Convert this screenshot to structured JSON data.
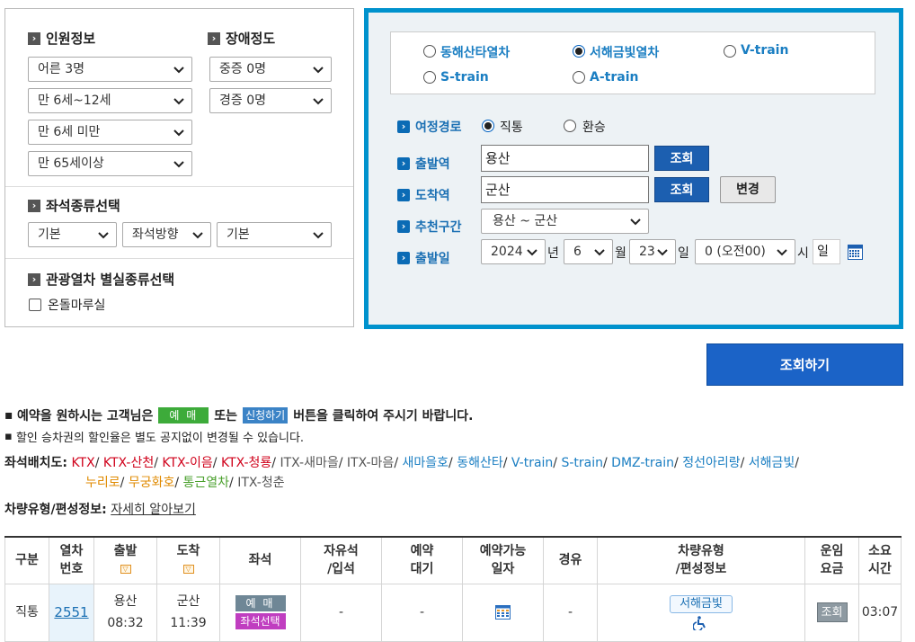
{
  "passenger": {
    "heading": "인원정보",
    "adult": "어른 3명",
    "child": "만 6세~12세",
    "infant": "만 6세 미만",
    "senior": "만 65세이상"
  },
  "disability": {
    "heading": "장애정도",
    "severe": "중증 0명",
    "mild": "경증 0명"
  },
  "seat_type": {
    "heading": "좌석종류선택",
    "type": "기본",
    "direction": "좌석방향",
    "position": "기본"
  },
  "tour_room": {
    "heading": "관광열차 별실종류선택",
    "ondol": "온돌마루실"
  },
  "trains": {
    "donghae": "동해산타열차",
    "seohae": "서해금빛열차",
    "vtrain": "V-train",
    "strain": "S-train",
    "atrain": "A-train"
  },
  "route": {
    "label": "여정경로",
    "direct": "직통",
    "transfer": "환승"
  },
  "departure": {
    "label": "출발역",
    "value": "용산",
    "lookup": "조회"
  },
  "arrival": {
    "label": "도착역",
    "value": "군산",
    "lookup": "조회",
    "swap": "변경"
  },
  "recommend": {
    "label": "추천구간",
    "value": "용산 ~ 군산"
  },
  "date": {
    "label": "출발일",
    "year": "2024",
    "year_unit": "년",
    "month": "6",
    "month_unit": "월",
    "day": "23",
    "day_unit": "일",
    "hour": "0 (오전00)",
    "hour_unit": "시",
    "weekday": "일"
  },
  "search_button": "조회하기",
  "notices": {
    "line1_a": "예약을 원하시는 고객님은",
    "line1_tag1": "예 매",
    "line1_b": "또는",
    "line1_tag2": "신청하기",
    "line1_c": "버튼을 클릭하여 주시기 바랍니다.",
    "line2": "할인 승차권의 할인율은 별도 공지없이 변경될 수 있습니다."
  },
  "seat_layout": {
    "label": "좌석배치도:",
    "items": [
      {
        "name": "KTX",
        "color": "#d0021b"
      },
      {
        "name": "KTX-산천",
        "color": "#d0021b"
      },
      {
        "name": "KTX-이음",
        "color": "#d0021b"
      },
      {
        "name": "KTX-청룡",
        "color": "#d0021b"
      },
      {
        "name": "ITX-새마을",
        "color": "#555555"
      },
      {
        "name": "ITX-마음",
        "color": "#555555"
      },
      {
        "name": "새마을호",
        "color": "#1a7ec2"
      },
      {
        "name": "동해산타",
        "color": "#1a7ec2"
      },
      {
        "name": "V-train",
        "color": "#1a7ec2"
      },
      {
        "name": "S-train",
        "color": "#1a7ec2"
      },
      {
        "name": "DMZ-train",
        "color": "#1a7ec2"
      },
      {
        "name": "정선아리랑",
        "color": "#1a7ec2"
      },
      {
        "name": "서해금빛",
        "color": "#1a7ec2"
      },
      {
        "name": "누리로",
        "color": "#e08a00"
      },
      {
        "name": "무궁화호",
        "color": "#e08a00"
      },
      {
        "name": "통근열차",
        "color": "#4aa02c"
      },
      {
        "name": "ITX-청춘",
        "color": "#555555"
      }
    ]
  },
  "vehicle_info": {
    "label": "차량유형/편성정보:",
    "link": "자세히 알아보기"
  },
  "table": {
    "headers": {
      "type": "구분",
      "train_no_1": "열차",
      "train_no_2": "번호",
      "dep": "출발",
      "arr": "도착",
      "seat": "좌석",
      "free_1": "자유석",
      "free_2": "/입석",
      "wait_1": "예약",
      "wait_2": "대기",
      "avail_1": "예약가능",
      "avail_2": "일자",
      "via": "경유",
      "vehicle_1": "차량유형",
      "vehicle_2": "/편성정보",
      "fare_1": "운임",
      "fare_2": "요금",
      "time_1": "소요",
      "time_2": "시간"
    },
    "row": {
      "type": "직통",
      "train_no": "2551",
      "dep_station": "용산",
      "dep_time": "08:32",
      "arr_station": "군산",
      "arr_time": "11:39",
      "reserve": "예 매",
      "seat_select": "좌석선택",
      "free": "-",
      "wait": "-",
      "via": "-",
      "vehicle": "서해금빛",
      "fare": "조회",
      "duration": "03:07"
    }
  }
}
